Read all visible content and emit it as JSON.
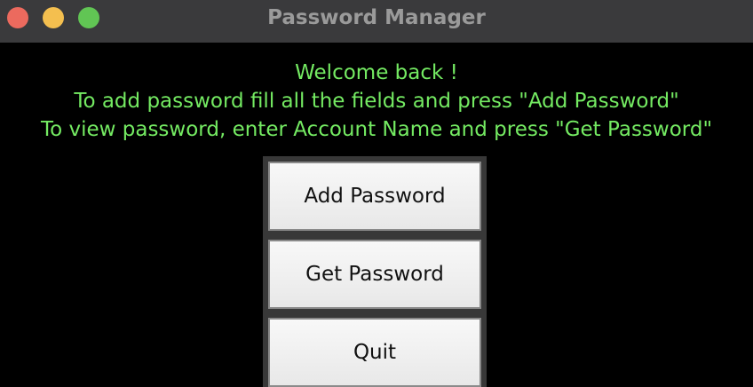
{
  "window": {
    "title": "Password Manager"
  },
  "message": {
    "line1": "Welcome back !",
    "line2": "To add password fill all the fields and press \"Add Password\"",
    "line3": "To view password, enter Account Name and press \"Get Password\""
  },
  "buttons": {
    "add_password": "Add Password",
    "get_password": "Get Password",
    "quit": "Quit"
  },
  "colors": {
    "background": "#000000",
    "message_text": "#74ea62",
    "titlebar": "#3a3a3c"
  },
  "icons": {
    "close": "close-icon",
    "minimize": "minimize-icon",
    "zoom": "zoom-icon"
  }
}
